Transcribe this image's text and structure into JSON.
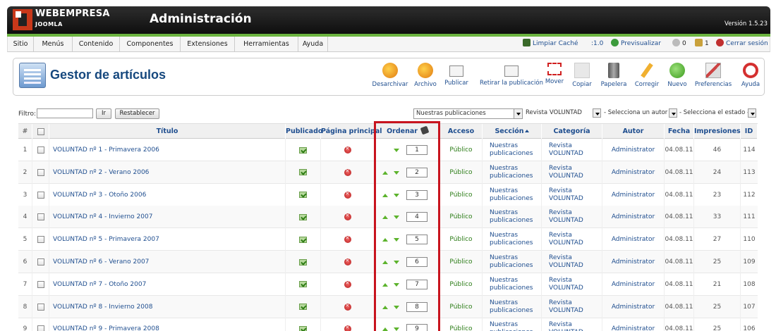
{
  "header": {
    "brand_line1": "WEBEMPRESA",
    "brand_line2": "JOOMLA",
    "title": "Administración",
    "version": "Versión 1.5.23"
  },
  "menu": [
    "Sitio",
    "Menús",
    "Contenido",
    "Componentes",
    "Extensiones",
    "Herramientas",
    "Ayuda"
  ],
  "status": {
    "clear_cache": "Limpiar Caché",
    "version_indicator": ":1.0",
    "preview": "Previsualizar",
    "messages": "0",
    "users": "1",
    "logout": "Cerrar sesión"
  },
  "page_title": "Gestor de artículos",
  "toolbar": [
    {
      "label": "Desarchivar",
      "icon": "unarchive-icon"
    },
    {
      "label": "Archivo",
      "icon": "archive-icon"
    },
    {
      "label": "Publicar",
      "icon": "publish-icon"
    },
    {
      "label": "Retirar la publicación",
      "icon": "unpublish-icon"
    },
    {
      "label": "Mover",
      "icon": "move-icon"
    },
    {
      "label": "Copiar",
      "icon": "copy-icon"
    },
    {
      "label": "Papelera",
      "icon": "trash-icon"
    },
    {
      "label": "Corregir",
      "icon": "edit-icon"
    },
    {
      "label": "Nuevo",
      "icon": "new-icon"
    },
    {
      "label": "Preferencias",
      "icon": "preferences-icon"
    },
    {
      "label": "Ayuda",
      "icon": "help-icon"
    }
  ],
  "filters": {
    "label": "Filtro:",
    "value": "",
    "go": "Ir",
    "reset": "Restablecer",
    "section": "Nuestras publicaciones",
    "category": "Revista VOLUNTAD",
    "author": "- Selecciona un autor -",
    "state": "- Selecciona el estado -"
  },
  "columns": {
    "num": "#",
    "title": "Título",
    "published": "Publicado",
    "frontpage": "Página principal",
    "order": "Ordenar",
    "access": "Acceso",
    "section": "Sección",
    "category": "Categoría",
    "author": "Autor",
    "date": "Fecha",
    "hits": "Impresiones",
    "id": "ID"
  },
  "rows": [
    {
      "num": "1",
      "title": "VOLUNTAD nº 1 - Primavera 2006",
      "order": "1",
      "access": "Público",
      "section": "Nuestras publicaciones",
      "category": "Revista VOLUNTAD",
      "author": "Administrator",
      "date": "04.08.11",
      "hits": "46",
      "id": "114"
    },
    {
      "num": "2",
      "title": "VOLUNTAD nº 2 - Verano 2006",
      "order": "2",
      "access": "Público",
      "section": "Nuestras publicaciones",
      "category": "Revista VOLUNTAD",
      "author": "Administrator",
      "date": "04.08.11",
      "hits": "24",
      "id": "113"
    },
    {
      "num": "3",
      "title": "VOLUNTAD nº 3 - Otoño 2006",
      "order": "3",
      "access": "Público",
      "section": "Nuestras publicaciones",
      "category": "Revista VOLUNTAD",
      "author": "Administrator",
      "date": "04.08.11",
      "hits": "23",
      "id": "112"
    },
    {
      "num": "4",
      "title": "VOLUNTAD nº 4 - Invierno 2007",
      "order": "4",
      "access": "Público",
      "section": "Nuestras publicaciones",
      "category": "Revista VOLUNTAD",
      "author": "Administrator",
      "date": "04.08.11",
      "hits": "33",
      "id": "111"
    },
    {
      "num": "5",
      "title": "VOLUNTAD nº 5 - Primavera 2007",
      "order": "5",
      "access": "Público",
      "section": "Nuestras publicaciones",
      "category": "Revista VOLUNTAD",
      "author": "Administrator",
      "date": "04.08.11",
      "hits": "27",
      "id": "110"
    },
    {
      "num": "6",
      "title": "VOLUNTAD nº 6 - Verano 2007",
      "order": "6",
      "access": "Público",
      "section": "Nuestras publicaciones",
      "category": "Revista VOLUNTAD",
      "author": "Administrator",
      "date": "04.08.11",
      "hits": "25",
      "id": "109"
    },
    {
      "num": "7",
      "title": "VOLUNTAD nº 7 - Otoño 2007",
      "order": "7",
      "access": "Público",
      "section": "Nuestras publicaciones",
      "category": "Revista VOLUNTAD",
      "author": "Administrator",
      "date": "04.08.11",
      "hits": "21",
      "id": "108"
    },
    {
      "num": "8",
      "title": "VOLUNTAD nº 8 - Invierno 2008",
      "order": "8",
      "access": "Público",
      "section": "Nuestras publicaciones",
      "category": "Revista VOLUNTAD",
      "author": "Administrator",
      "date": "04.08.11",
      "hits": "25",
      "id": "107"
    },
    {
      "num": "9",
      "title": "VOLUNTAD nº 9 - Primavera 2008",
      "order": "9",
      "access": "Público",
      "section": "Nuestras publicaciones",
      "category": "Revista VOLUNTAD",
      "author": "Administrator",
      "date": "04.08.11",
      "hits": "25",
      "id": "106"
    }
  ]
}
